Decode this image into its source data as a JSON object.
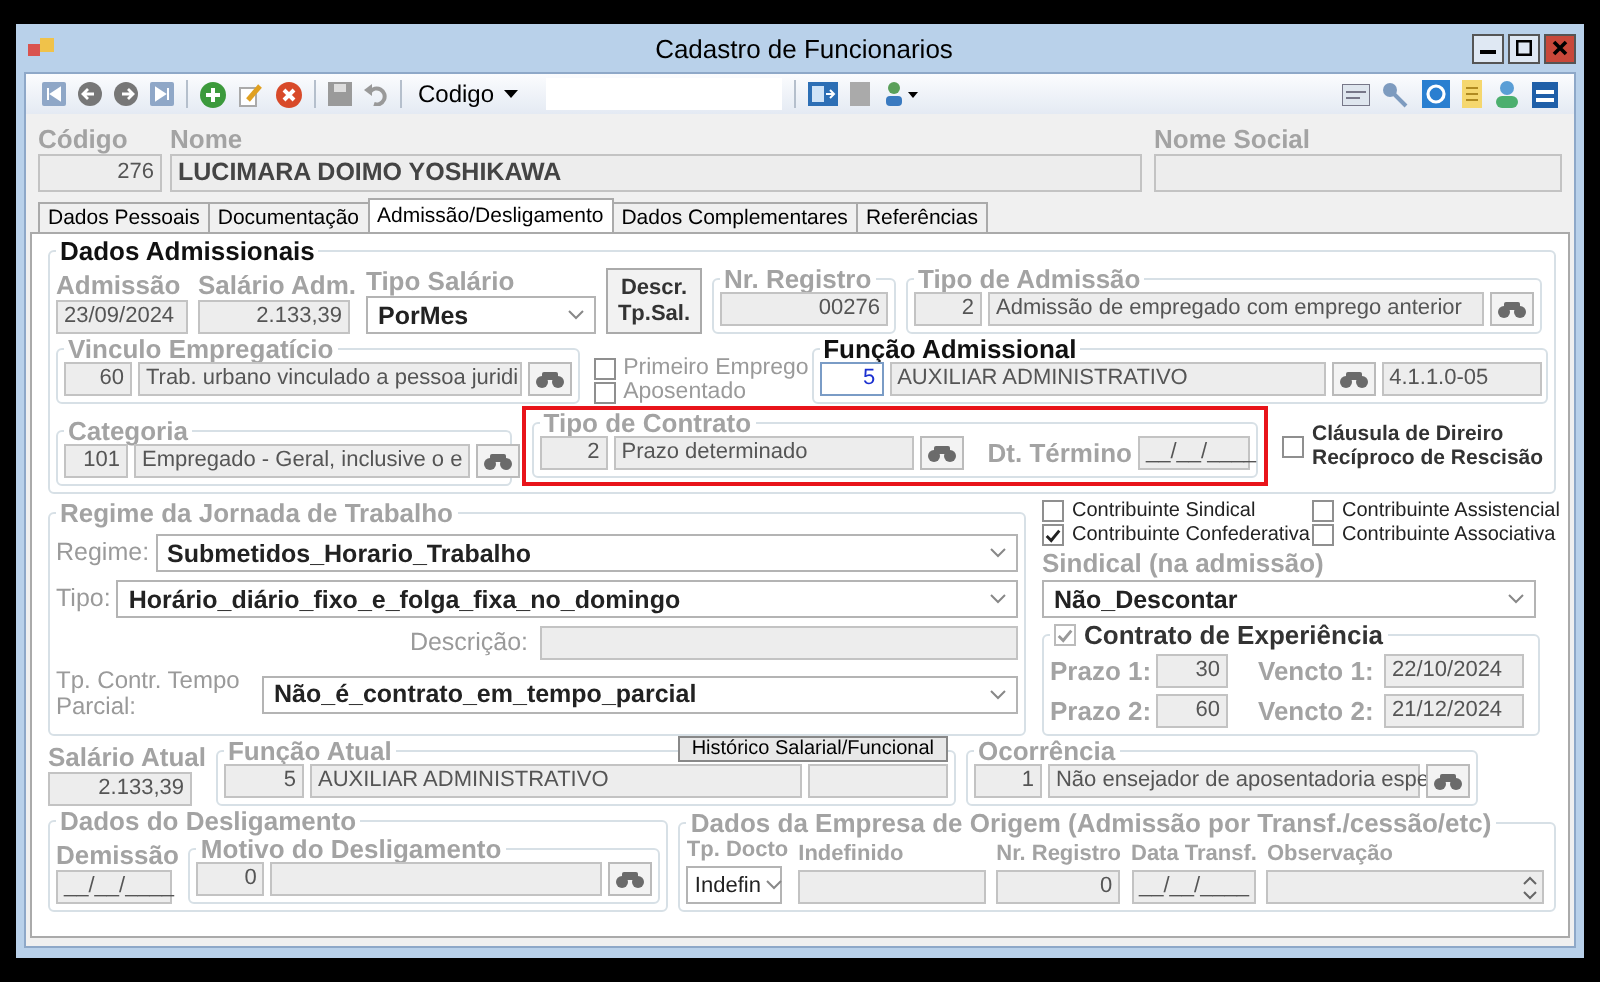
{
  "window": {
    "title": "Cadastro de Funcionarios"
  },
  "toolbar": {
    "search_by": "Codigo"
  },
  "header": {
    "codigo": {
      "label": "Código",
      "value": "276"
    },
    "nome": {
      "label": "Nome",
      "value": "LUCIMARA DOIMO YOSHIKAWA"
    },
    "nome_social": {
      "label": "Nome Social"
    }
  },
  "tabs": [
    {
      "label": "Dados Pessoais",
      "selected": false
    },
    {
      "label": "Documentação",
      "selected": false
    },
    {
      "label": "Admissão/Desligamento",
      "selected": true
    },
    {
      "label": "Dados Complementares",
      "selected": false
    },
    {
      "label": "Referências",
      "selected": false
    }
  ],
  "admissao": {
    "title": "Dados Admissionais",
    "admissao": {
      "label": "Admissão",
      "value": "23/09/2024"
    },
    "salario_adm": {
      "label": "Salário Adm.",
      "value": "2.133,39"
    },
    "tipo_salario": {
      "label": "Tipo Salário",
      "value": "PorMes"
    },
    "descr_button": "Descr. Tp.Sal.",
    "nr_registro": {
      "label": "Nr. Registro",
      "value": "00276"
    },
    "tipo_admissao": {
      "label": "Tipo de Admissão",
      "code": "2",
      "value": "Admissão de empregado com emprego anterior"
    },
    "vinculo": {
      "label": "Vinculo Empregatício",
      "code": "60",
      "value": "Trab. urbano vinculado a pessoa juridi"
    },
    "flags": [
      {
        "label": "Primeiro Emprego",
        "checked": false
      },
      {
        "label": "Aposentado",
        "checked": false
      }
    ],
    "funcao": {
      "label": "Função Admissional",
      "code": "5",
      "value": "AUXILIAR ADMINISTRATIVO",
      "cbo": "4.1.1.0-05"
    },
    "categoria": {
      "label": "Categoria",
      "code": "101",
      "value": "Empregado - Geral, inclusive o e"
    },
    "tipo_contrato": {
      "label": "Tipo de Contrato",
      "code": "2",
      "value": "Prazo determinado",
      "highlighted": true
    },
    "dt_termino": {
      "label": "Dt. Término",
      "value": "__/__/____"
    },
    "clausula": {
      "label": "Cláusula de Direiro Recíproco de Rescisão",
      "checked": false
    }
  },
  "regime": {
    "title": "Regime da Jornada de Trabalho",
    "regime": {
      "label": "Regime:",
      "value": "Submetidos_Horario_Trabalho"
    },
    "tipo": {
      "label": "Tipo:",
      "value": "Horário_diário_fixo_e_folga_fixa_no_domingo"
    },
    "descricao": {
      "label": "Descrição:"
    },
    "tempo_parcial": {
      "label": "Tp. Contr. Tempo Parcial:",
      "value": "Não_é_contrato_em_tempo_parcial"
    }
  },
  "contribuicoes": [
    {
      "label": "Contribuinte Sindical",
      "checked": false
    },
    {
      "label": "Contribuinte Assistencial",
      "checked": false
    },
    {
      "label": "Contribuinte Confederativa",
      "checked": true
    },
    {
      "label": "Contribuinte Associativa",
      "checked": false
    }
  ],
  "sindical": {
    "label": "Sindical (na admissão)",
    "value": "Não_Descontar"
  },
  "experiencia": {
    "label": "Contrato de Experiência",
    "checked": true,
    "prazos": [
      {
        "label": "Prazo 1:",
        "value": "30",
        "vencto_label": "Vencto 1:",
        "vencto": "22/10/2024"
      },
      {
        "label": "Prazo 2:",
        "value": "60",
        "vencto_label": "Vencto 2:",
        "vencto": "21/12/2024"
      }
    ]
  },
  "atual": {
    "salario": {
      "label": "Salário Atual",
      "value": "2.133,39"
    },
    "funcao": {
      "label": "Função Atual",
      "code": "5",
      "value": "AUXILIAR ADMINISTRATIVO"
    },
    "historico_button": "Histórico Salarial/Funcional",
    "ocorrencia": {
      "label": "Ocorrência",
      "code": "1",
      "value": "Não ensejador de aposentadoria espe"
    }
  },
  "desligamento": {
    "title": "Dados do Desligamento",
    "demissao": {
      "label": "Demissão",
      "value": "__/__/____"
    },
    "motivo": {
      "label": "Motivo do Desligamento",
      "code": "0"
    }
  },
  "origem": {
    "title": "Dados da Empresa de Origem (Admissão por Transf./cessão/etc)",
    "tp_docto": {
      "label": "Tp. Docto",
      "value": "Indefin"
    },
    "indefinido": {
      "label": "Indefinido"
    },
    "nr_registro": {
      "label": "Nr. Registro",
      "value": "0"
    },
    "data_transf": {
      "label": "Data Transf.",
      "value": "__/__/____"
    },
    "observacao": {
      "label": "Observação"
    }
  }
}
